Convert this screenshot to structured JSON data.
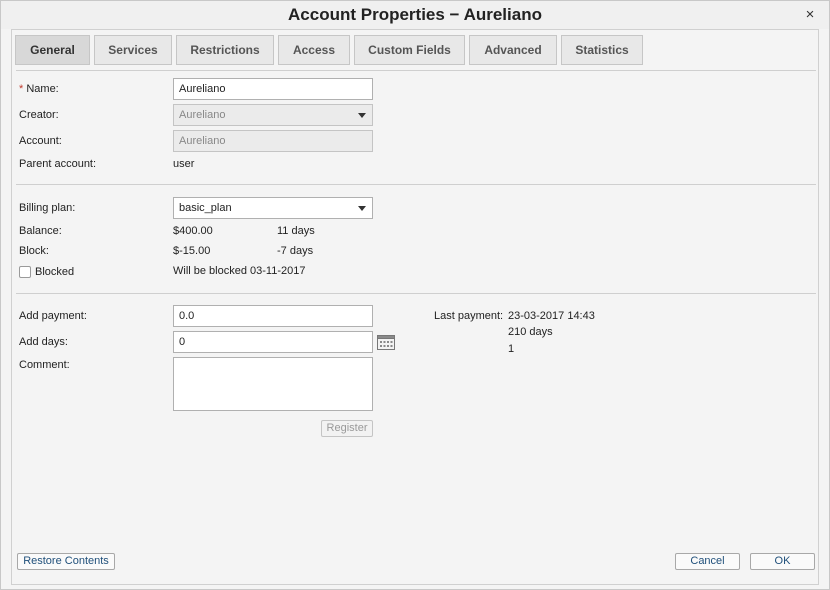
{
  "window": {
    "title": "Account Properties − Aureliano",
    "close_glyph": "×"
  },
  "tabs": [
    {
      "label": "General",
      "active": true
    },
    {
      "label": "Services"
    },
    {
      "label": "Restrictions"
    },
    {
      "label": "Access"
    },
    {
      "label": "Custom Fields"
    },
    {
      "label": "Advanced"
    },
    {
      "label": "Statistics"
    }
  ],
  "general": {
    "required_mark": "*",
    "name_label": "Name:",
    "name_value": "Aureliano",
    "creator_label": "Creator:",
    "creator_value": "Aureliano",
    "account_label": "Account:",
    "account_value": "Aureliano",
    "parent_label": "Parent account:",
    "parent_value": "user"
  },
  "billing": {
    "plan_label": "Billing plan:",
    "plan_value": "basic_plan",
    "balance_label": "Balance:",
    "balance_value": "$400.00",
    "balance_days": "11 days",
    "block_label": "Block:",
    "block_value": "$-15.00",
    "block_days": "-7 days",
    "blocked_label": "Blocked",
    "blocked_checked": false,
    "block_notice": "Will be blocked 03-11-2017"
  },
  "payment": {
    "add_payment_label": "Add payment:",
    "add_payment_value": "0.0",
    "add_days_label": "Add days:",
    "add_days_value": "0",
    "comment_label": "Comment:",
    "register_label": "Register",
    "last_payment_label": "Last payment:",
    "last_payment_date": "23-03-2017 14:43",
    "last_payment_days": "210 days",
    "last_payment_count": "1"
  },
  "footer": {
    "restore_label": "Restore Contents",
    "cancel_label": "Cancel",
    "ok_label": "OK"
  },
  "icons": {
    "close": "close-icon",
    "dropdown": "chevron-down-icon",
    "calendar": "calendar-icon"
  }
}
